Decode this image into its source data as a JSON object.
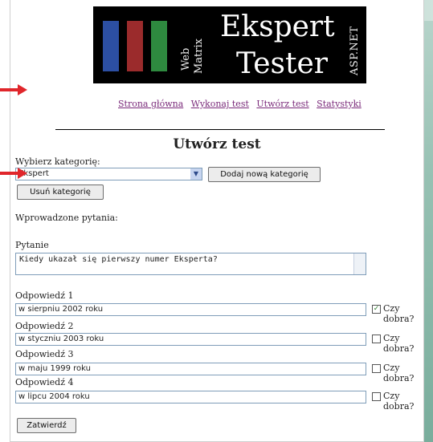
{
  "logo": {
    "web": "Web",
    "matrix": "Matrix",
    "title_line1": "Ekspert",
    "title_line2": "Tester",
    "aspnet": "ASP.NET"
  },
  "nav": [
    {
      "label": "Strona główna"
    },
    {
      "label": "Wykonaj test"
    },
    {
      "label": "Utwórz test"
    },
    {
      "label": "Statystyki"
    }
  ],
  "heading": "Utwórz test",
  "category": {
    "label": "Wybierz kategorię:",
    "selected": "Ekspert",
    "add_button": "Dodaj nową kategorię",
    "remove_button": "Usuń kategorię"
  },
  "entered_questions_label": "Wprowadzone pytania:",
  "question": {
    "label": "Pytanie",
    "value": "Kiedy ukazał się pierwszy numer Eksperta?"
  },
  "answers": [
    {
      "label": "Odpowiedź 1",
      "value": "w sierpniu 2002 roku",
      "correct_label": "Czy dobra?",
      "checked": true
    },
    {
      "label": "Odpowiedź 2",
      "value": "w styczniu 2003 roku",
      "correct_label": "Czy dobra?",
      "checked": false
    },
    {
      "label": "Odpowiedź 3",
      "value": "w maju 1999 roku",
      "correct_label": "Czy dobra?",
      "checked": false
    },
    {
      "label": "Odpowiedź 4",
      "value": "w lipcu 2004 roku",
      "correct_label": "Czy dobra?",
      "checked": false
    }
  ],
  "submit_button": "Zatwierdź",
  "colors": {
    "arrow": "#e0262b",
    "link": "#7a2a7a"
  }
}
